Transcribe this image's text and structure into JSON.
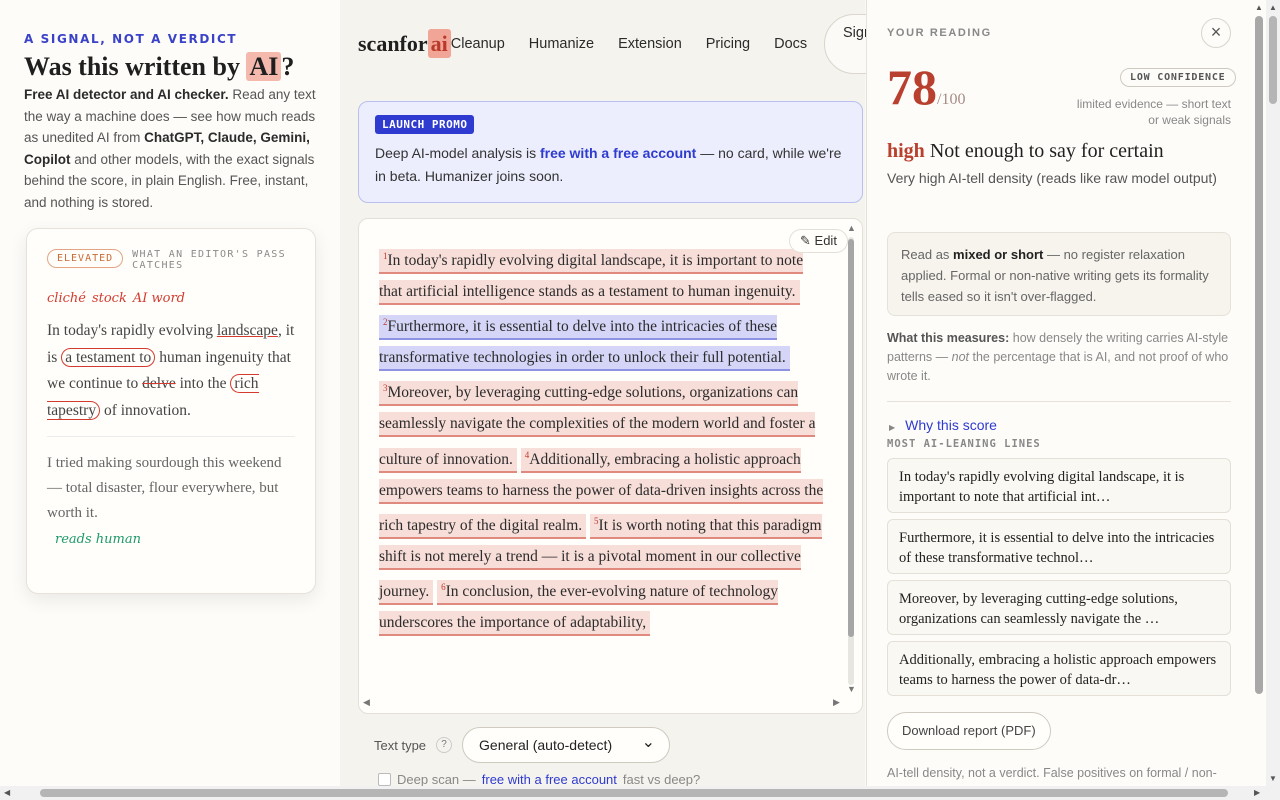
{
  "hero": {
    "eyebrow": "A SIGNAL, NOT A VERDICT",
    "title_before": "Was this written by ",
    "title_mark": "AI",
    "title_after": "?",
    "desc_lead": "Free AI detector and AI checker.",
    "desc_1": " Read any text the way a machine does — see how much reads as unedited AI from ",
    "desc_models": "ChatGPT, Claude, Gemini, Copilot",
    "desc_2": " and other models, with the exact signals behind the score, in plain English. Free, instant, and nothing is stored."
  },
  "editor_card": {
    "badge": "ELEVATED",
    "label": "WHAT AN EDITOR'S PASS CATCHES",
    "tags": [
      "cliché",
      "stock",
      "AI word"
    ],
    "sample1": {
      "t1": "In today's rapidly evolving ",
      "t1u": "landscape",
      "t2": ", it is ",
      "t2c": "a testament to",
      "t3": " human ingenuity that we continue to ",
      "t3s": "delve",
      "t4": " into the ",
      "t4c": "rich tapestry",
      "t5": " of innovation."
    },
    "sample2": "I tried making sourdough this weekend — total disaster, flour everywhere, but worth it.",
    "reads_human": "reads human"
  },
  "nav": {
    "logo_text": "scanfor",
    "logo_mark": "ai",
    "links": [
      "Cleanup",
      "Humanize",
      "Extension",
      "Pricing",
      "Docs"
    ],
    "signin": "Sign in"
  },
  "promo": {
    "badge": "LAUNCH PROMO",
    "text_1": "Deep AI-model analysis is ",
    "link": "free with a free account",
    "text_2": " — no card, while we're in beta. Humanizer joins soon."
  },
  "editor": {
    "edit_label": "Edit",
    "sentences": [
      {
        "n": "1",
        "text": "In today's rapidly evolving digital landscape, it is important to note that artificial intelligence stands as a testament to human ingenuity.",
        "hl": "red"
      },
      {
        "n": "2",
        "text": "Furthermore, it is essential to delve into the intricacies of these transformative technologies in order to unlock their full potential.",
        "hl": "blue"
      },
      {
        "n": "3",
        "text": "Moreover, by leveraging cutting-edge solutions, organizations can seamlessly navigate the complexities of the modern world and foster a culture of innovation.",
        "hl": "red"
      },
      {
        "n": "4",
        "text": "Additionally, embracing a holistic approach empowers teams to harness the power of data-driven insights across the rich tapestry of the digital realm.",
        "hl": "red"
      },
      {
        "n": "5",
        "text": "It is worth noting that this paradigm shift is not merely a trend — it is a pivotal moment in our collective journey.",
        "hl": "red"
      },
      {
        "n": "6",
        "text": "In conclusion, the ever-evolving nature of technology underscores the importance of adaptability,",
        "hl": "red"
      }
    ],
    "text_type_label": "Text type",
    "text_type_value": "General (auto-detect)",
    "deep_scan_label": "Deep scan —",
    "deep_scan_link": "free with a free account",
    "deep_scan_hint": "fast vs deep?"
  },
  "reading": {
    "title": "YOUR READING",
    "score": "78",
    "score_max": "/100",
    "confidence": "LOW CONFIDENCE",
    "confidence_note": "limited evidence — short text or weak signals",
    "level": "high",
    "verdict": "Not enough to say for certain",
    "subtitle": "Very high AI-tell density (reads like raw model output)",
    "register_1": "Read as ",
    "register_bold": "mixed or short",
    "register_2": " — no register relaxation applied. Formal or non-native writing gets its formality tells eased so it isn't over-flagged.",
    "measures_label": "What this measures:",
    "measures_1": " how densely the writing carries AI-style patterns — ",
    "measures_not": "not",
    "measures_2": " the percentage that is AI, and not proof of who wrote it.",
    "why": "Why this score",
    "lines_title": "MOST AI-LEANING LINES",
    "lines": [
      "In today's rapidly evolving digital landscape, it is important to note that artificial int…",
      "Furthermore, it is essential to delve into the intricacies of these transformative technol…",
      "Moreover, by leveraging cutting-edge solutions, organizations can seamlessly navigate the …",
      "Additionally, embracing a holistic approach empowers teams to harness the power of data-dr…"
    ],
    "download": "Download report (PDF)",
    "footnote": "AI-tell density, not a verdict. False positives on formal / non-"
  }
}
